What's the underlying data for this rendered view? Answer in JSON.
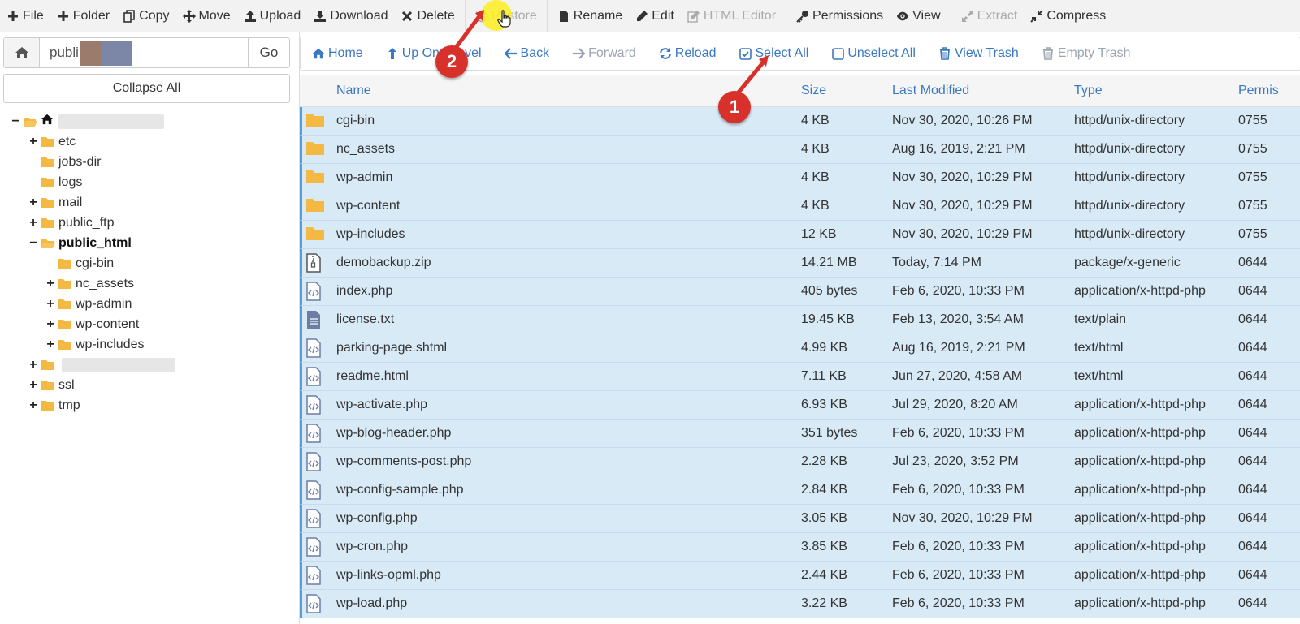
{
  "toolbar": {
    "items": [
      {
        "label": "File",
        "icon": "plus-icon",
        "disabled": false
      },
      {
        "label": "Folder",
        "icon": "plus-icon",
        "disabled": false
      },
      {
        "label": "Copy",
        "icon": "copy-icon",
        "disabled": false
      },
      {
        "label": "Move",
        "icon": "move-icon",
        "disabled": false
      },
      {
        "label": "Upload",
        "icon": "upload-icon",
        "disabled": false
      },
      {
        "label": "Download",
        "icon": "download-icon",
        "disabled": false
      },
      {
        "label": "Delete",
        "icon": "close-icon",
        "disabled": false
      },
      {
        "label": "Restore",
        "icon": "undo-icon",
        "disabled": true
      },
      {
        "label": "Rename",
        "icon": "file-icon",
        "disabled": false
      },
      {
        "label": "Edit",
        "icon": "pencil-icon",
        "disabled": false
      },
      {
        "label": "HTML Editor",
        "icon": "pencil-square-icon",
        "disabled": true
      },
      {
        "label": "Permissions",
        "icon": "key-icon",
        "disabled": false
      },
      {
        "label": "View",
        "icon": "eye-icon",
        "disabled": false
      },
      {
        "label": "Extract",
        "icon": "expand-icon",
        "disabled": true
      },
      {
        "label": "Compress",
        "icon": "compress-icon",
        "disabled": false
      }
    ]
  },
  "sidebar": {
    "path_value": "publi",
    "go_label": "Go",
    "collapse_label": "Collapse All",
    "tree": [
      {
        "label": "",
        "toggle": "−",
        "level": 0,
        "open": true,
        "home": true,
        "redacted": true
      },
      {
        "label": "etc",
        "toggle": "+",
        "level": 1
      },
      {
        "label": "jobs-dir",
        "toggle": "",
        "level": 1
      },
      {
        "label": "logs",
        "toggle": "",
        "level": 1
      },
      {
        "label": "mail",
        "toggle": "+",
        "level": 1
      },
      {
        "label": "public_ftp",
        "toggle": "+",
        "level": 1
      },
      {
        "label": "public_html",
        "toggle": "−",
        "level": 1,
        "open": true,
        "bold": true
      },
      {
        "label": "cgi-bin",
        "toggle": "",
        "level": 2
      },
      {
        "label": "nc_assets",
        "toggle": "+",
        "level": 2
      },
      {
        "label": "wp-admin",
        "toggle": "+",
        "level": 2
      },
      {
        "label": "wp-content",
        "toggle": "+",
        "level": 2
      },
      {
        "label": "wp-includes",
        "toggle": "+",
        "level": 2
      },
      {
        "label": "",
        "toggle": "+",
        "level": 1,
        "redacted": true
      },
      {
        "label": "ssl",
        "toggle": "+",
        "level": 1
      },
      {
        "label": "tmp",
        "toggle": "+",
        "level": 1
      }
    ]
  },
  "navbar": {
    "items": [
      {
        "label": "Home",
        "icon": "home-icon",
        "disabled": false
      },
      {
        "label": "Up One Level",
        "icon": "level-up-icon",
        "disabled": false
      },
      {
        "label": "Back",
        "icon": "arrow-left-icon",
        "disabled": false
      },
      {
        "label": "Forward",
        "icon": "arrow-right-icon",
        "disabled": true
      },
      {
        "label": "Reload",
        "icon": "refresh-icon",
        "disabled": false
      },
      {
        "label": "Select All",
        "icon": "checkbox-checked-icon",
        "disabled": false
      },
      {
        "label": "Unselect All",
        "icon": "checkbox-empty-icon",
        "disabled": false
      },
      {
        "label": "View Trash",
        "icon": "trash-icon",
        "disabled": false
      },
      {
        "label": "Empty Trash",
        "icon": "trash-icon",
        "disabled": true
      }
    ]
  },
  "table": {
    "columns": [
      "Name",
      "Size",
      "Last Modified",
      "Type",
      "Permis"
    ],
    "rows": [
      {
        "name": "cgi-bin",
        "size": "4 KB",
        "modified": "Nov 30, 2020, 10:26 PM",
        "type": "httpd/unix-directory",
        "perms": "0755",
        "kind": "folder"
      },
      {
        "name": "nc_assets",
        "size": "4 KB",
        "modified": "Aug 16, 2019, 2:21 PM",
        "type": "httpd/unix-directory",
        "perms": "0755",
        "kind": "folder"
      },
      {
        "name": "wp-admin",
        "size": "4 KB",
        "modified": "Nov 30, 2020, 10:29 PM",
        "type": "httpd/unix-directory",
        "perms": "0755",
        "kind": "folder"
      },
      {
        "name": "wp-content",
        "size": "4 KB",
        "modified": "Nov 30, 2020, 10:29 PM",
        "type": "httpd/unix-directory",
        "perms": "0755",
        "kind": "folder"
      },
      {
        "name": "wp-includes",
        "size": "12 KB",
        "modified": "Nov 30, 2020, 10:29 PM",
        "type": "httpd/unix-directory",
        "perms": "0755",
        "kind": "folder"
      },
      {
        "name": "demobackup.zip",
        "size": "14.21 MB",
        "modified": "Today, 7:14 PM",
        "type": "package/x-generic",
        "perms": "0644",
        "kind": "zip"
      },
      {
        "name": "index.php",
        "size": "405 bytes",
        "modified": "Feb 6, 2020, 10:33 PM",
        "type": "application/x-httpd-php",
        "perms": "0644",
        "kind": "code"
      },
      {
        "name": "license.txt",
        "size": "19.45 KB",
        "modified": "Feb 13, 2020, 3:54 AM",
        "type": "text/plain",
        "perms": "0644",
        "kind": "text"
      },
      {
        "name": "parking-page.shtml",
        "size": "4.99 KB",
        "modified": "Aug 16, 2019, 2:21 PM",
        "type": "text/html",
        "perms": "0644",
        "kind": "code"
      },
      {
        "name": "readme.html",
        "size": "7.11 KB",
        "modified": "Jun 27, 2020, 4:58 AM",
        "type": "text/html",
        "perms": "0644",
        "kind": "code"
      },
      {
        "name": "wp-activate.php",
        "size": "6.93 KB",
        "modified": "Jul 29, 2020, 8:20 AM",
        "type": "application/x-httpd-php",
        "perms": "0644",
        "kind": "code"
      },
      {
        "name": "wp-blog-header.php",
        "size": "351 bytes",
        "modified": "Feb 6, 2020, 10:33 PM",
        "type": "application/x-httpd-php",
        "perms": "0644",
        "kind": "code"
      },
      {
        "name": "wp-comments-post.php",
        "size": "2.28 KB",
        "modified": "Jul 23, 2020, 3:52 PM",
        "type": "application/x-httpd-php",
        "perms": "0644",
        "kind": "code"
      },
      {
        "name": "wp-config-sample.php",
        "size": "2.84 KB",
        "modified": "Feb 6, 2020, 10:33 PM",
        "type": "application/x-httpd-php",
        "perms": "0644",
        "kind": "code"
      },
      {
        "name": "wp-config.php",
        "size": "3.05 KB",
        "modified": "Nov 30, 2020, 10:29 PM",
        "type": "application/x-httpd-php",
        "perms": "0644",
        "kind": "code"
      },
      {
        "name": "wp-cron.php",
        "size": "3.85 KB",
        "modified": "Feb 6, 2020, 10:33 PM",
        "type": "application/x-httpd-php",
        "perms": "0644",
        "kind": "code"
      },
      {
        "name": "wp-links-opml.php",
        "size": "2.44 KB",
        "modified": "Feb 6, 2020, 10:33 PM",
        "type": "application/x-httpd-php",
        "perms": "0644",
        "kind": "code"
      },
      {
        "name": "wp-load.php",
        "size": "3.22 KB",
        "modified": "Feb 6, 2020, 10:33 PM",
        "type": "application/x-httpd-php",
        "perms": "0644",
        "kind": "code"
      }
    ]
  },
  "annotations": {
    "badge_1": "1",
    "badge_2": "2"
  },
  "colors": {
    "accent": "#3b78c4",
    "row_selected": "#d9eaf7",
    "folder": "#f4b942",
    "badge": "#d8312c"
  }
}
